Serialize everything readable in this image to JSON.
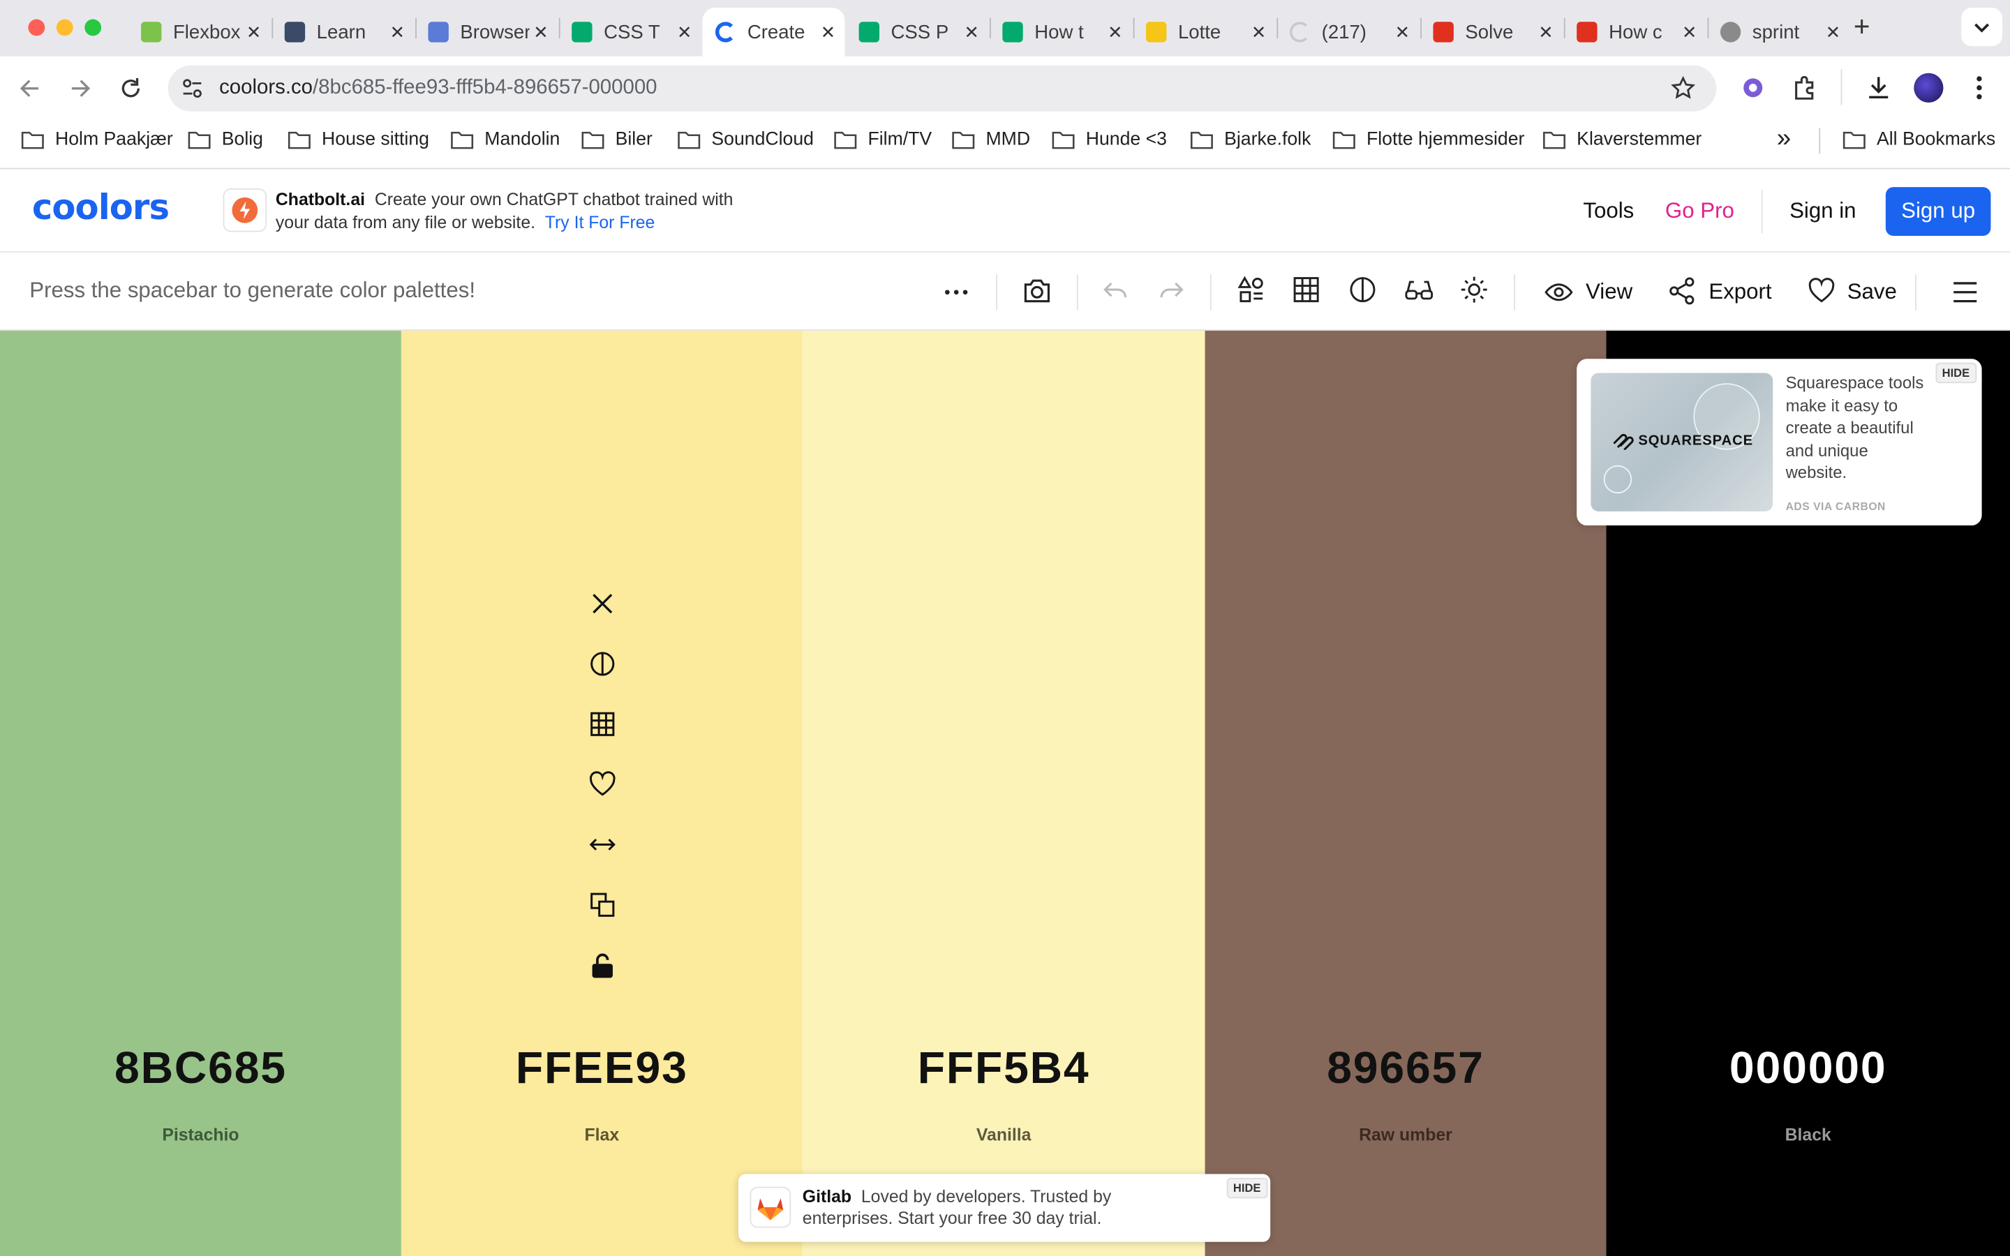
{
  "browser": {
    "tabs": [
      {
        "title": "Flexbox",
        "icon": "android-icon",
        "color": "#7cc34a"
      },
      {
        "title": "Learn",
        "icon": "w3-icon",
        "color": "#3b4a66"
      },
      {
        "title": "Browser",
        "icon": "browser-icon",
        "color": "#5a7bd6"
      },
      {
        "title": "CSS T",
        "icon": "w3schools-icon",
        "color": "#04aa6d"
      },
      {
        "title": "Create",
        "icon": "coolors-icon",
        "color": "#1a64f0"
      },
      {
        "title": "CSS P",
        "icon": "w3schools-icon",
        "color": "#04aa6d"
      },
      {
        "title": "How t",
        "icon": "w3schools-icon",
        "color": "#04aa6d"
      },
      {
        "title": "Lotte",
        "icon": "imdb-icon",
        "color": "#f5c518"
      },
      {
        "title": "(217)",
        "icon": "loading-icon",
        "color": "#c9c9c9"
      },
      {
        "title": "Solve",
        "icon": "adobe-icon",
        "color": "#e0301e"
      },
      {
        "title": "How c",
        "icon": "adobe-icon",
        "color": "#e0301e"
      },
      {
        "title": "sprint",
        "icon": "globe-icon",
        "color": "#7a7a7a"
      }
    ],
    "active_tab": 4,
    "url_host": "coolors.co",
    "url_path": "/8bc685-ffee93-fff5b4-896657-000000",
    "bookmarks": [
      "Holm Paakjær",
      "Bolig",
      "House sitting",
      "Mandolin",
      "Biler",
      "SoundCloud",
      "Film/TV",
      "MMD",
      "Hunde <3",
      "Bjarke.folk",
      "Flotte hjemmesider",
      "Klaverstemmer"
    ],
    "all_bookmarks": "All Bookmarks",
    "more_bookmarks": "»"
  },
  "header": {
    "logo": "coolors",
    "ad": {
      "brand": "Chatbolt.ai",
      "text": "Create your own ChatGPT chatbot trained with your data from any file or website.",
      "cta": "Try It For Free"
    },
    "tools": "Tools",
    "gopro": "Go Pro",
    "signin": "Sign in",
    "signup": "Sign up",
    "gopro_color": "#e0218a",
    "accent": "#1a64f0"
  },
  "toolbar": {
    "hint": "Press the spacebar to generate color palettes!",
    "view": "View",
    "export": "Export",
    "save": "Save"
  },
  "palette": [
    {
      "hex": "8BC685",
      "name": "Pistachio",
      "color": "#98c48a",
      "text_color": "#111111",
      "name_color": "#3d5a38"
    },
    {
      "hex": "FFEE93",
      "name": "Flax",
      "color": "#fcea9d",
      "text_color": "#111111",
      "name_color": "#5e5630"
    },
    {
      "hex": "FFF5B4",
      "name": "Vanilla",
      "color": "#fcf3b9",
      "text_color": "#111111",
      "name_color": "#5e5a3e"
    },
    {
      "hex": "896657",
      "name": "Raw umber",
      "color": "#86685a",
      "text_color": "#111111",
      "name_color": "#3b2a22"
    },
    {
      "hex": "000000",
      "name": "Black",
      "color": "#000000",
      "text_color": "#ffffff",
      "name_color": "#9a9a9a"
    }
  ],
  "column_tools": [
    "close-icon",
    "contrast-icon",
    "shades-grid-icon",
    "heart-icon",
    "drag-arrows-icon",
    "copy-icon",
    "lock-icon"
  ],
  "ads": {
    "squarespace": {
      "logo": "SQUARESPACE",
      "text": "Squarespace tools make it easy to create a beautiful and unique website.",
      "via": "ADS VIA CARBON",
      "hide": "HIDE"
    },
    "gitlab": {
      "brand": "Gitlab",
      "text": "Loved by developers. Trusted by enterprises. Start your free 30 day trial.",
      "hide": "HIDE"
    }
  }
}
